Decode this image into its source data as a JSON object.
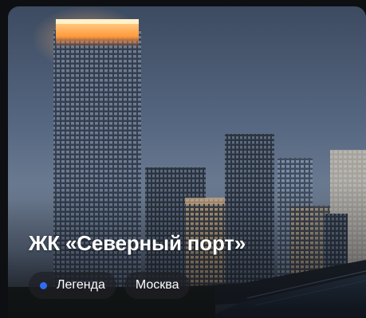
{
  "card": {
    "title": "ЖК «Северный порт»",
    "tags": [
      {
        "label": "Легенда",
        "dot_color": "#2f6cf5"
      },
      {
        "label": "Москва"
      }
    ]
  },
  "colors": {
    "tag_background": "rgba(30,32,38,0.72)",
    "title_text": "#ffffff"
  }
}
